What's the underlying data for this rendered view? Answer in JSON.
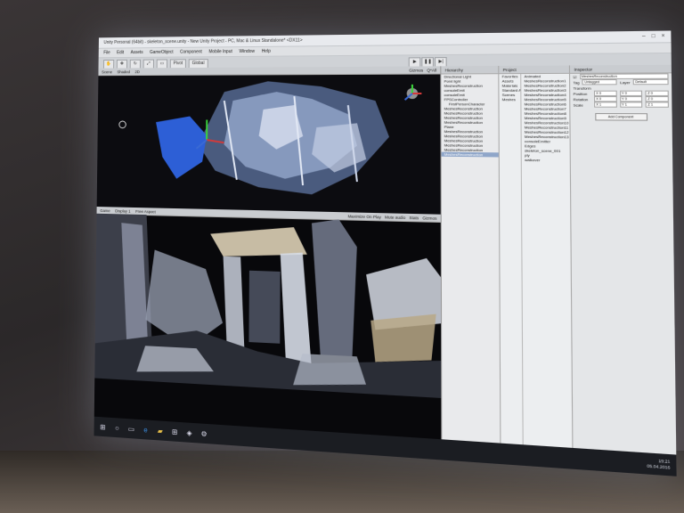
{
  "window": {
    "title": "Unity Personal (64bit) - skeleton_scene.unity - New Unity Project - PC, Mac & Linux Standalone* <DX11>",
    "controls": [
      "–",
      "□",
      "×"
    ]
  },
  "menu": [
    "File",
    "Edit",
    "Assets",
    "GameObject",
    "Component",
    "Mobile Input",
    "Window",
    "Help"
  ],
  "toolbar": {
    "tools": [
      "hand-icon",
      "move-icon",
      "rotate-icon",
      "scale-icon",
      "rect-icon"
    ],
    "pivot_label": "Pivot",
    "global_label": "Global",
    "play": "▶",
    "pause": "❚❚",
    "step": "▶|"
  },
  "scene_panel": {
    "tab": "Scene",
    "shading": "Shaded",
    "mode": "2D",
    "right_items": [
      "Gizmos",
      "Q*All"
    ]
  },
  "game_panel": {
    "tab": "Game",
    "display": "Display 1",
    "aspect": "Free Aspect",
    "right_items": [
      "Maximize On Play",
      "Mute audio",
      "Stats",
      "Gizmos"
    ]
  },
  "hierarchy": {
    "tab": "Hierarchy",
    "items": [
      {
        "label": "Directional Light",
        "sub": false,
        "selected": false
      },
      {
        "label": "Point light",
        "sub": false,
        "selected": false
      },
      {
        "label": "MeshesReconstruction",
        "sub": false,
        "selected": false
      },
      {
        "label": "consoleEmit",
        "sub": false,
        "selected": false
      },
      {
        "label": "consoleEmit",
        "sub": false,
        "selected": false
      },
      {
        "label": "FPSController",
        "sub": false,
        "selected": false
      },
      {
        "label": "FirstPersonCharacter",
        "sub": true,
        "selected": false
      },
      {
        "label": "MeshesReconstruction",
        "sub": false,
        "selected": false
      },
      {
        "label": "MeshesReconstruction",
        "sub": false,
        "selected": false
      },
      {
        "label": "MeshesReconstruction",
        "sub": false,
        "selected": false
      },
      {
        "label": "MeshesReconstruction",
        "sub": false,
        "selected": false
      },
      {
        "label": "Plane",
        "sub": false,
        "selected": false
      },
      {
        "label": "MeshesReconstruction",
        "sub": false,
        "selected": false
      },
      {
        "label": "MeshesReconstruction",
        "sub": false,
        "selected": false
      },
      {
        "label": "MeshesReconstruction",
        "sub": false,
        "selected": false
      },
      {
        "label": "MeshesReconstruction",
        "sub": false,
        "selected": false
      },
      {
        "label": "MeshesReconstruction",
        "sub": false,
        "selected": false
      },
      {
        "label": "MeshesReconstruction",
        "sub": false,
        "selected": true
      }
    ]
  },
  "project": {
    "tab": "Project",
    "folders": [
      "Favorites",
      "Assets",
      "Materials",
      "Standard Assets",
      "Scenes",
      "Meshes"
    ],
    "assets": [
      "Animated",
      "MeshesReconstruction1",
      "MeshesReconstruction2",
      "MeshesReconstruction3",
      "MeshesReconstruction4",
      "MeshesReconstruction5",
      "MeshesReconstruction6",
      "MeshesReconstruction7",
      "MeshesReconstruction8",
      "MeshesReconstruction9",
      "MeshesReconstruction10",
      "MeshesReconstruction11",
      "MeshesReconstruction12",
      "MeshesReconstruction13",
      "consoleEmitter",
      "Edges",
      "skeleton_scene_001",
      "ply",
      "walkover"
    ]
  },
  "inspector": {
    "tab": "Inspector",
    "object_name": "MeshesReconstruction",
    "tag_label": "Tag",
    "tag_value": "Untagged",
    "layer_label": "Layer",
    "layer_value": "Default",
    "transform_label": "Transform",
    "rows": [
      {
        "label": "Position",
        "x": "X 0",
        "y": "Y 0",
        "z": "Z 0"
      },
      {
        "label": "Rotation",
        "x": "X 0",
        "y": "Y 0",
        "z": "Z 0"
      },
      {
        "label": "Scale",
        "x": "X 1",
        "y": "Y 1",
        "z": "Z 1"
      }
    ],
    "add_component": "Add Component"
  },
  "taskbar": {
    "icons": [
      "windows-start-icon",
      "search-icon",
      "task-view-icon",
      "edge-browser-icon",
      "file-explorer-icon",
      "store-icon",
      "unity-icon",
      "settings-icon"
    ],
    "time": "19:21",
    "date": "05.04.2016"
  },
  "colors": {
    "scene_background": "#0c0c10",
    "selected_mesh": "#2d5fd6",
    "gizmo_x": "#d43a3a",
    "gizmo_y": "#3ad43a",
    "gizmo_z": "#3a6ad4",
    "selection_highlight": "#8fa6c9"
  }
}
